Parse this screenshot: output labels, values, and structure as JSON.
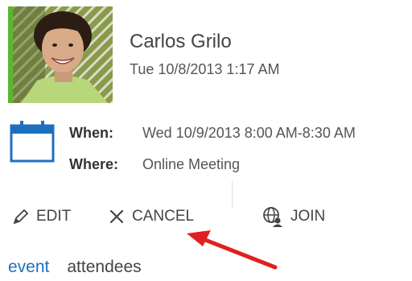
{
  "sender": {
    "name": "Carlos Grilo",
    "sent_time": "Tue 10/8/2013 1:17 AM",
    "presence_color": "#5cb531"
  },
  "meeting": {
    "when_label": "When:",
    "when_value": "Wed 10/9/2013 8:00 AM-8:30 AM",
    "where_label": "Where:",
    "where_value": "Online Meeting",
    "calendar_icon": "calendar-icon"
  },
  "actions": {
    "edit_label": "EDIT",
    "cancel_label": "CANCEL",
    "join_label": "JOIN"
  },
  "tabs": [
    {
      "label": "event",
      "active": true
    },
    {
      "label": "attendees",
      "active": false
    }
  ],
  "colors": {
    "accent": "#1f6fbf",
    "annotation": "#e02020"
  }
}
